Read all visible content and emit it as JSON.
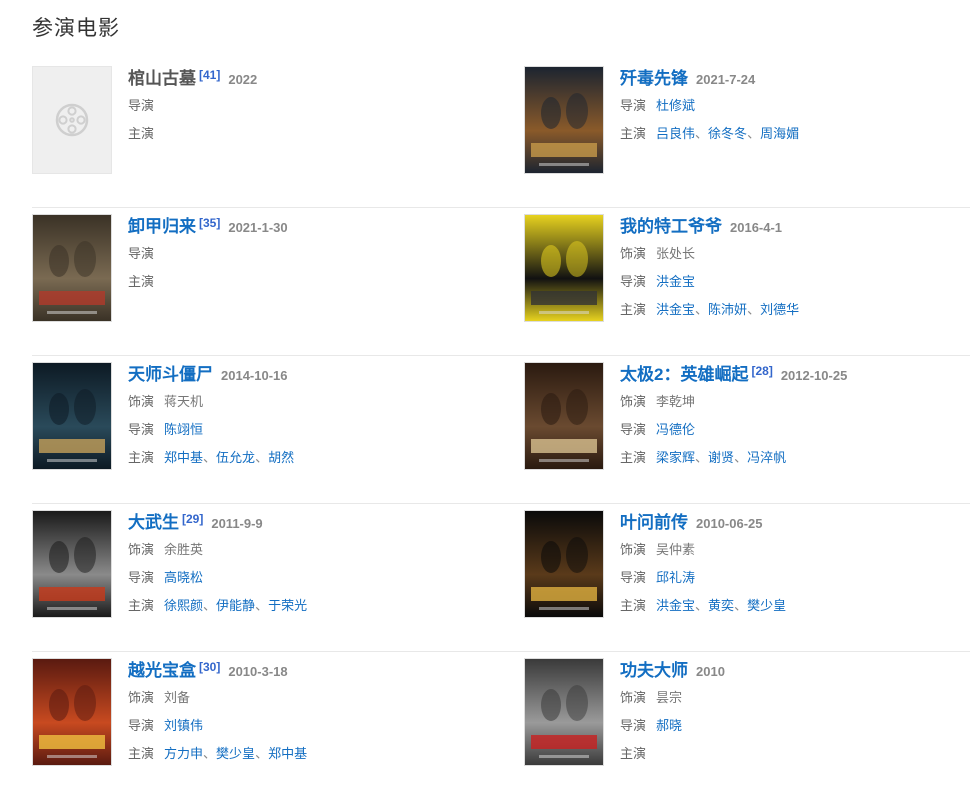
{
  "section_title": "参演电影",
  "labels": {
    "role": "饰演",
    "director": "导演",
    "cast": "主演"
  },
  "sep": "、",
  "rows": [
    {
      "left": {
        "title": "棺山古墓",
        "title_link": false,
        "ref": "[41]",
        "date": "2022",
        "has_poster": false,
        "role": null,
        "directors": [],
        "cast": []
      },
      "right": {
        "title": "歼毒先锋",
        "title_link": true,
        "ref": "",
        "date": "2021-7-24",
        "has_poster": true,
        "poster_colors": [
          "#1c2430",
          "#8a5a2a",
          "#c79a4a"
        ],
        "poster_text": "歼毒先锋",
        "role": null,
        "directors": [
          "杜修斌"
        ],
        "cast": [
          "吕良伟",
          "徐冬冬",
          "周海媚"
        ]
      }
    },
    {
      "left": {
        "title": "卸甲归来",
        "title_link": true,
        "ref": "[35]",
        "date": "2021-1-30",
        "has_poster": true,
        "poster_colors": [
          "#3a3226",
          "#7a6a52",
          "#b23a2a"
        ],
        "poster_text": "卸甲归来",
        "role": null,
        "directors": [],
        "cast": []
      },
      "right": {
        "title": "我的特工爷爷",
        "title_link": true,
        "ref": "",
        "date": "2016-4-1",
        "has_poster": true,
        "poster_colors": [
          "#e7d21f",
          "#111111",
          "#333333"
        ],
        "poster_text": "我的特工爷爷",
        "role": "张处长",
        "directors": [
          "洪金宝"
        ],
        "cast": [
          "洪金宝",
          "陈沛妍",
          "刘德华"
        ]
      }
    },
    {
      "left": {
        "title": "天师斗僵尸",
        "title_link": true,
        "ref": "",
        "date": "2014-10-16",
        "has_poster": true,
        "poster_colors": [
          "#0d1a24",
          "#2a4a5a",
          "#c4a05a"
        ],
        "poster_text": "天师斗僵尸",
        "role": "蒋天机",
        "directors": [
          "陈翊恒"
        ],
        "cast": [
          "郑中基",
          "伍允龙",
          "胡然"
        ]
      },
      "right": {
        "title": "太极2：英雄崛起",
        "title_link": true,
        "ref": "[28]",
        "date": "2012-10-25",
        "has_poster": true,
        "poster_colors": [
          "#2a1a10",
          "#6a4a30",
          "#d8c090"
        ],
        "poster_text": "太极2",
        "role": "李乾坤",
        "directors": [
          "冯德伦"
        ],
        "cast": [
          "梁家辉",
          "谢贤",
          "冯淬帆"
        ]
      }
    },
    {
      "left": {
        "title": "大武生",
        "title_link": true,
        "ref": "[29]",
        "date": "2011-9-9",
        "has_poster": true,
        "poster_colors": [
          "#1a1a1a",
          "#8a8a8a",
          "#c83a1a"
        ],
        "poster_text": "大武生",
        "role": "余胜英",
        "directors": [
          "高晓松"
        ],
        "cast": [
          "徐熙颜",
          "伊能静",
          "于荣光"
        ]
      },
      "right": {
        "title": "叶问前传",
        "title_link": true,
        "ref": "",
        "date": "2010-06-25",
        "has_poster": true,
        "poster_colors": [
          "#0a0a0a",
          "#5a3a1a",
          "#e0b040"
        ],
        "poster_text": "葉問3",
        "role": "吴仲素",
        "directors": [
          "邱礼涛"
        ],
        "cast": [
          "洪金宝",
          "黄奕",
          "樊少皇"
        ]
      }
    },
    {
      "left": {
        "title": "越光宝盒",
        "title_link": true,
        "ref": "[30]",
        "date": "2010-3-18",
        "has_poster": true,
        "poster_colors": [
          "#5a1a10",
          "#c84a20",
          "#f0c040"
        ],
        "poster_text": "越光宝盒",
        "role": "刘备",
        "directors": [
          "刘镇伟"
        ],
        "cast": [
          "方力申",
          "樊少皇",
          "郑中基"
        ]
      },
      "right": {
        "title": "功夫大师",
        "title_link": true,
        "ref": "",
        "date": "2010",
        "has_poster": true,
        "poster_colors": [
          "#3a3a3a",
          "#9a9a9a",
          "#c82020"
        ],
        "poster_text": "쿵푸마스터",
        "role": "昙宗",
        "directors": [
          "郝晓"
        ],
        "cast": []
      }
    }
  ]
}
